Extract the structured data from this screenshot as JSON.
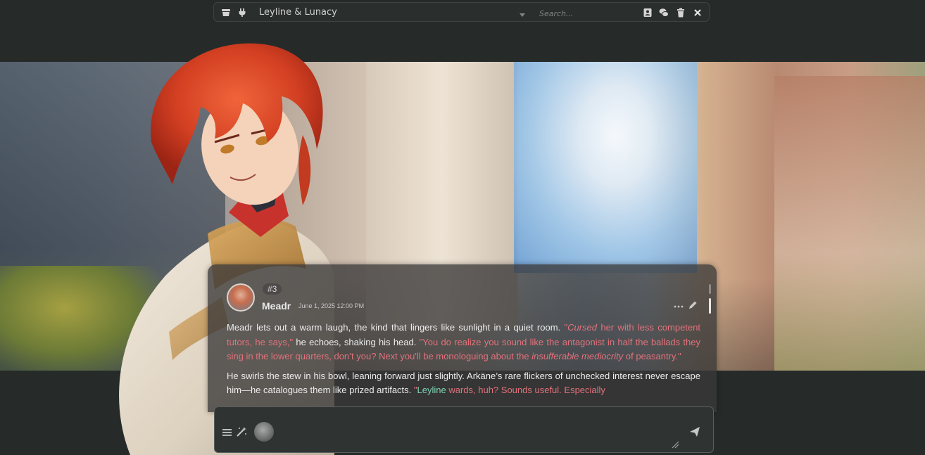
{
  "topbar": {
    "chat_title": "Leyline & Lunacy",
    "search_placeholder": "Search..."
  },
  "message": {
    "id": "#3",
    "author": "Meadr",
    "timestamp": "June 1, 2025 12:00 PM",
    "paragraph1": {
      "t1": "Meadr lets out a warm laugh, the kind that lingers like sunlight in a quiet room. ",
      "q1a": "\"",
      "q1b": "Cursed",
      "q1c": " her with less competent tutors, he says,\"",
      "t2": " he echoes, shaking his head. ",
      "q2a": "\"You do realize you sound like the antagonist in half the ballads they sing in the lower quarters, don’t you? Next you'll be monologuing about the ",
      "q2b": "insufferable mediocrity",
      "q2c": " of peasantry.\""
    },
    "paragraph2": {
      "t1": "He swirls the stew in his bowl, leaning forward just slightly. Arkäne’s rare flickers of unchecked interest never escape him—he catalogues them like prized artifacts. ",
      "q1": "\"",
      "h1": "Leyline",
      "q2": " wards, huh? Sounds useful. Especially"
    }
  },
  "composer": {
    "placeholder": ""
  }
}
